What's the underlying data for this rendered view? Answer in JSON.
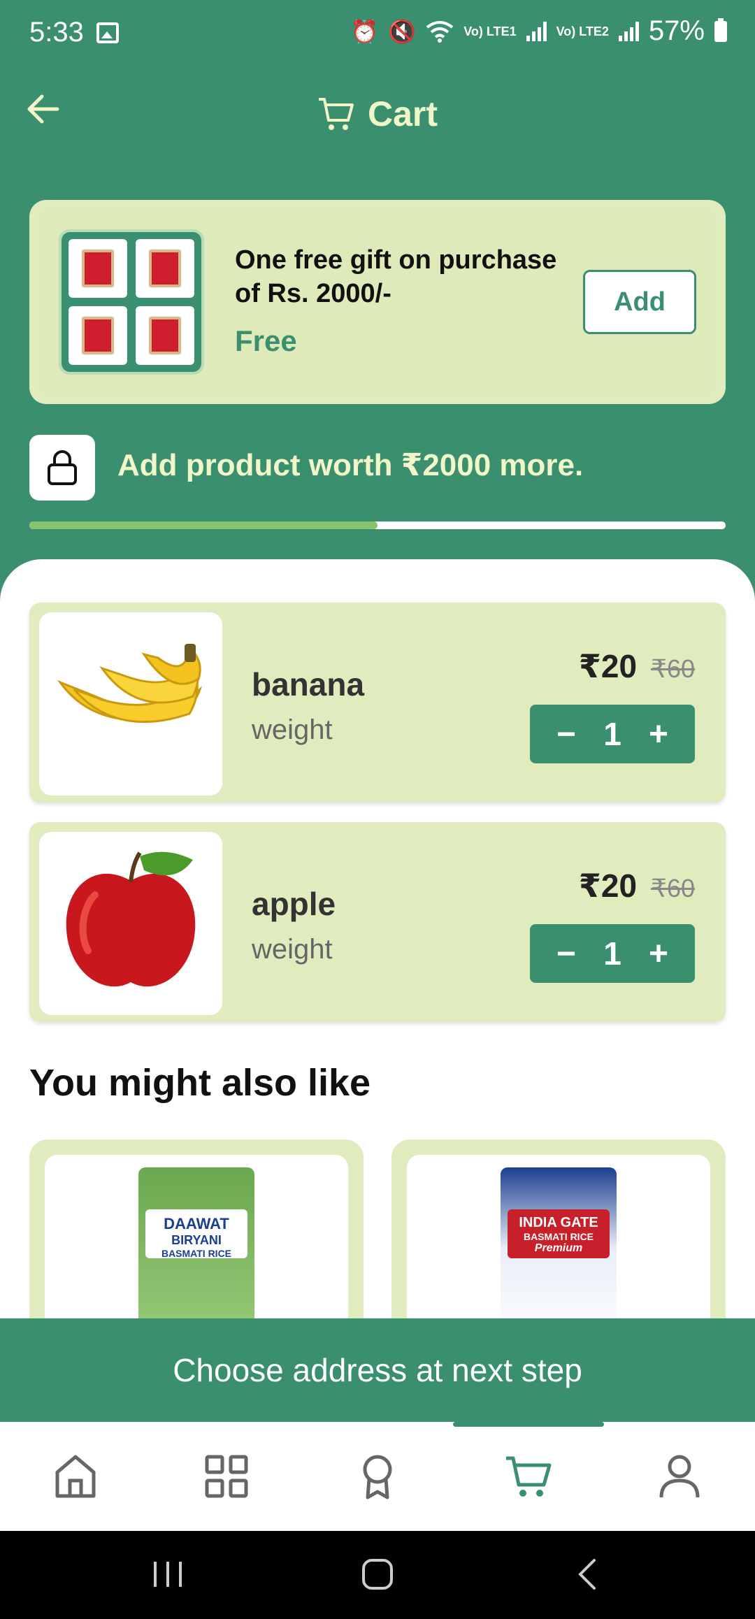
{
  "status_bar": {
    "time": "5:33",
    "lte1": "Vo) LTE1",
    "lte2": "Vo) LTE2",
    "battery": "57%"
  },
  "header": {
    "title": "Cart"
  },
  "gift": {
    "title": "One free gift on purchase of Rs. 2000/-",
    "price_label": "Free",
    "add_label": "Add"
  },
  "threshold": {
    "message": "Add product worth ₹2000 more.",
    "progress_fraction": 0.5
  },
  "cart_items": [
    {
      "name": "banana",
      "unit": "weight",
      "price": "₹20",
      "mrp": "₹60",
      "qty": "1"
    },
    {
      "name": "apple",
      "unit": "weight",
      "price": "₹20",
      "mrp": "₹60",
      "qty": "1"
    }
  ],
  "stepper": {
    "minus": "−",
    "plus": "+"
  },
  "suggestions": {
    "title": "You might also like",
    "items": [
      {
        "brand": "DAAWAT",
        "line": "BIRYANI",
        "sub": "BASMATI RICE"
      },
      {
        "brand": "INDIA GATE",
        "line": "BASMATI RICE",
        "sub": "Premium"
      }
    ]
  },
  "cta": {
    "label": "Choose address at next step"
  },
  "bottom_nav": {
    "items": [
      "home-icon",
      "categories-icon",
      "rewards-icon",
      "cart-icon",
      "profile-icon"
    ],
    "active_index": 3
  },
  "colors": {
    "primary": "#3a8f6e",
    "card": "#e1ecbe",
    "accent_text": "#f1f6c8",
    "progress_fill": "#86c56e"
  }
}
